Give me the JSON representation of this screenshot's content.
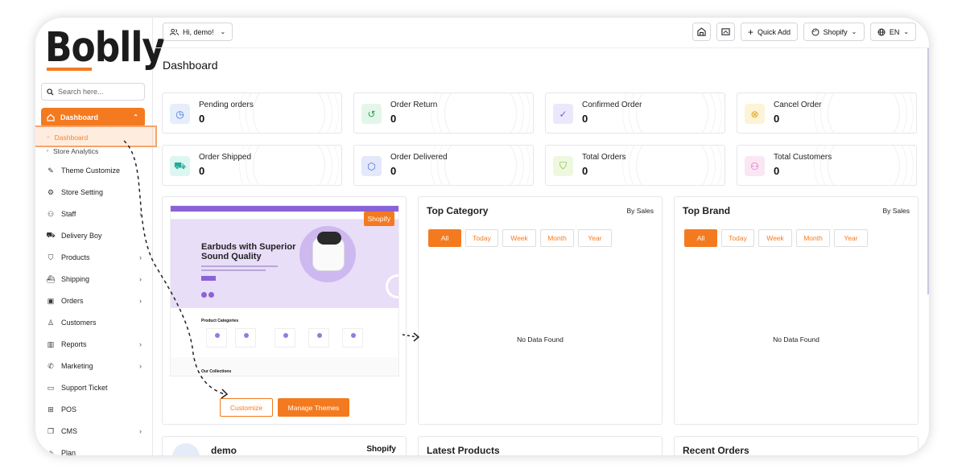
{
  "logo": {
    "text": "Boblly"
  },
  "search": {
    "placeholder": "Search here..."
  },
  "sidebar": {
    "active": {
      "label": "Dashboard"
    },
    "subitems": [
      {
        "label": "Dashboard"
      },
      {
        "label": "Store Analytics"
      }
    ],
    "items": [
      {
        "label": "Theme Customize",
        "icon": "brush-icon",
        "arrow": false
      },
      {
        "label": "Store Setting",
        "icon": "gear-icon",
        "arrow": false
      },
      {
        "label": "Staff",
        "icon": "users-icon",
        "arrow": true
      },
      {
        "label": "Delivery Boy",
        "icon": "truck-icon",
        "arrow": false
      },
      {
        "label": "Products",
        "icon": "cart-icon",
        "arrow": true
      },
      {
        "label": "Shipping",
        "icon": "shipping-icon",
        "arrow": true
      },
      {
        "label": "Orders",
        "icon": "box-icon",
        "arrow": true
      },
      {
        "label": "Customers",
        "icon": "user-icon",
        "arrow": false
      },
      {
        "label": "Reports",
        "icon": "chart-icon",
        "arrow": true
      },
      {
        "label": "Marketing",
        "icon": "megaphone-icon",
        "arrow": true
      },
      {
        "label": "Support Ticket",
        "icon": "ticket-icon",
        "arrow": false
      },
      {
        "label": "POS",
        "icon": "pos-icon",
        "arrow": false
      },
      {
        "label": "CMS",
        "icon": "layers-icon",
        "arrow": true
      },
      {
        "label": "Plan",
        "icon": "plan-icon",
        "arrow": false
      }
    ]
  },
  "topbar": {
    "greeting": "Hi, demo!",
    "quick_add": "Quick Add",
    "store": "Shopify",
    "language": "EN"
  },
  "page": {
    "title": "Dashboard"
  },
  "stats": [
    {
      "label": "Pending orders",
      "value": "0",
      "color": "#e6eefc",
      "icon_color": "#3b6fd8"
    },
    {
      "label": "Order Return",
      "value": "0",
      "color": "#e4f6ea",
      "icon_color": "#2ea55a"
    },
    {
      "label": "Confirmed Order",
      "value": "0",
      "color": "#ece8fb",
      "icon_color": "#7b5fd6"
    },
    {
      "label": "Cancel Order",
      "value": "0",
      "color": "#fdf3d6",
      "icon_color": "#d9a416"
    },
    {
      "label": "Order Shipped",
      "value": "0",
      "color": "#dcf6f1",
      "icon_color": "#23a99a"
    },
    {
      "label": "Order Delivered",
      "value": "0",
      "color": "#e3e8fb",
      "icon_color": "#5066d4"
    },
    {
      "label": "Total Orders",
      "value": "0",
      "color": "#eef8df",
      "icon_color": "#7ab32c"
    },
    {
      "label": "Total Customers",
      "value": "0",
      "color": "#fbe6f4",
      "icon_color": "#d055b4"
    }
  ],
  "theme": {
    "tag": "Shopify",
    "hero_title_1": "Earbuds with Superior",
    "hero_title_2": "Sound Quality",
    "categories_title": "Product Categories",
    "collections_title": "Our Collections",
    "customize": "Customize",
    "manage": "Manage Themes"
  },
  "top_category": {
    "title": "Top Category",
    "sort": "By Sales",
    "filters": [
      "All",
      "Today",
      "Week",
      "Month",
      "Year"
    ],
    "empty": "No Data Found"
  },
  "top_brand": {
    "title": "Top Brand",
    "sort": "By Sales",
    "filters": [
      "All",
      "Today",
      "Week",
      "Month",
      "Year"
    ],
    "empty": "No Data Found"
  },
  "bottom": {
    "store_name": "demo",
    "store_platform": "Shopify",
    "latest_products": "Latest Products",
    "recent_orders": "Recent Orders"
  },
  "colors": {
    "accent": "#f47a20",
    "preview": "#8b62d6"
  }
}
